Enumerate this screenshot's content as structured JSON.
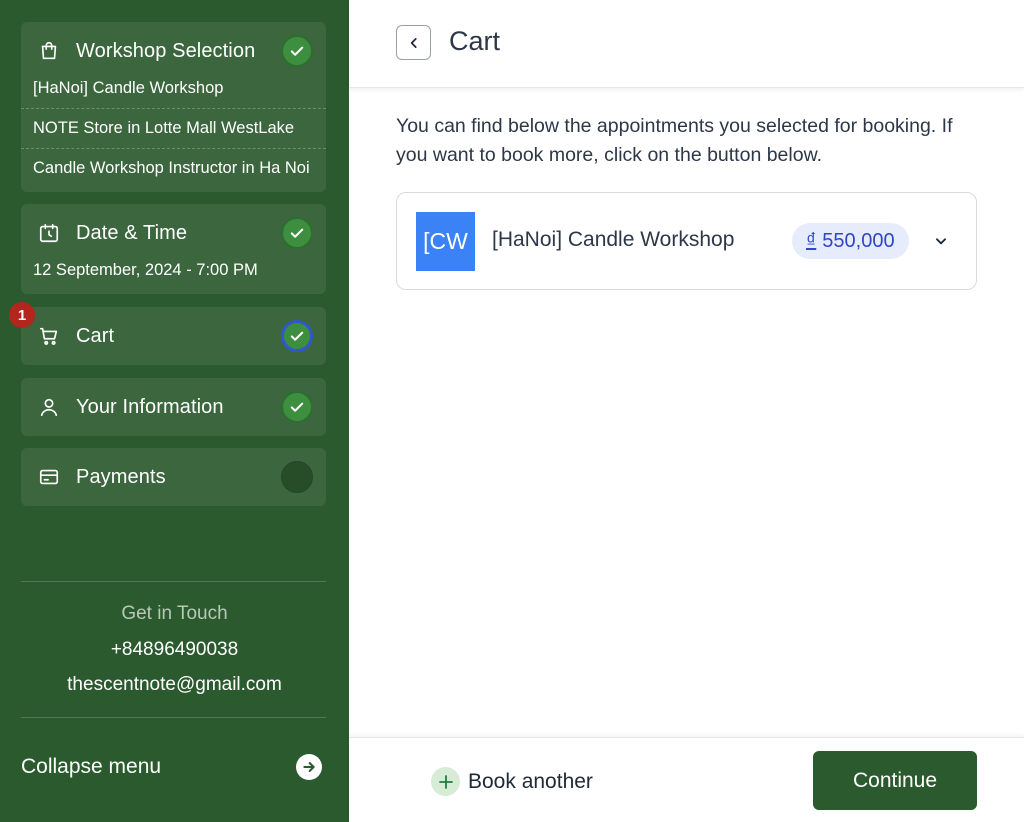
{
  "sidebar": {
    "steps": [
      {
        "label": "Workshop Selection",
        "icon": "shopping-bag-icon",
        "status": "done",
        "details": [
          "[HaNoi] Candle Workshop",
          "NOTE Store in Lotte Mall WestLake",
          "Candle Workshop Instructor in Ha Noi"
        ]
      },
      {
        "label": "Date & Time",
        "icon": "calendar-clock-icon",
        "status": "done",
        "details": [
          "12 September, 2024 - 7:00 PM"
        ]
      },
      {
        "label": "Cart",
        "icon": "cart-icon",
        "status": "current",
        "badge": "1"
      },
      {
        "label": "Your Information",
        "icon": "user-icon",
        "status": "done"
      },
      {
        "label": "Payments",
        "icon": "credit-card-icon",
        "status": "pending"
      }
    ],
    "contact": {
      "title": "Get in Touch",
      "phone": "+84896490038",
      "email": "thescentnote@gmail.com"
    },
    "collapse_label": "Collapse menu"
  },
  "main": {
    "title": "Cart",
    "intro": "You can find below the appointments you selected for booking. If you want to book more, click on the button below.",
    "cart_items": [
      {
        "thumb_text": "[CW",
        "name": "[HaNoi] Candle Workshop",
        "currency": "₫",
        "price": "550,000"
      }
    ],
    "book_another_label": "Book another",
    "continue_label": "Continue"
  },
  "colors": {
    "sidebar_bg": "#2b5a2e",
    "check_green": "#3e8e3f",
    "current_ring": "#2f58c9",
    "thumb_blue": "#3b82f6",
    "price_text": "#2f46c9",
    "badge_red": "#b3261e"
  }
}
